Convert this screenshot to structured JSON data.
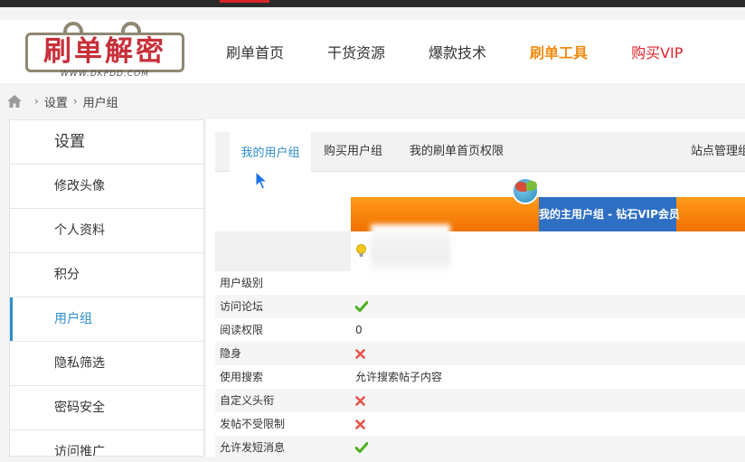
{
  "logo": {
    "text": "刷单解密",
    "subtext": "WWW.DKPDD.COM"
  },
  "nav": {
    "items": [
      {
        "label": "刷单首页"
      },
      {
        "label": "干货资源"
      },
      {
        "label": "爆款技术"
      },
      {
        "label": "刷单工具"
      },
      {
        "label": "购买VIP"
      }
    ]
  },
  "breadcrumb": {
    "home_icon": "home-icon",
    "items": [
      "设置",
      "用户组"
    ]
  },
  "sidebar": {
    "title": "设置",
    "items": [
      {
        "label": "修改头像"
      },
      {
        "label": "个人资料"
      },
      {
        "label": "积分"
      },
      {
        "label": "用户组"
      },
      {
        "label": "隐私筛选"
      },
      {
        "label": "密码安全"
      },
      {
        "label": "访问推广"
      }
    ],
    "active_index": 3
  },
  "tabs": [
    {
      "label": "我的用户组"
    },
    {
      "label": "购买用户组"
    },
    {
      "label": "我的刷单首页权限"
    },
    {
      "label": "站点管理组"
    }
  ],
  "group": {
    "banner_label": "我的主用户组 - 钻石VIP会员"
  },
  "permissions": [
    {
      "label": "用户级别",
      "value": ""
    },
    {
      "label": "访问论坛",
      "value": "",
      "icon": "check-icon"
    },
    {
      "label": "阅读权限",
      "value": "0"
    },
    {
      "label": "隐身",
      "value": "",
      "icon": "cross-icon"
    },
    {
      "label": "使用搜索",
      "value": "允许搜索帖子内容"
    },
    {
      "label": "自定义头衔",
      "value": "",
      "icon": "cross-icon"
    },
    {
      "label": "发帖不受限制",
      "value": "",
      "icon": "cross-icon"
    },
    {
      "label": "允许发短消息",
      "value": "",
      "icon": "check-icon"
    }
  ],
  "colors": {
    "accent_blue": "#2d8ecb",
    "tools_orange": "#f08c12",
    "vip_red": "#e0242b",
    "banner_orange": "#ff8a00",
    "banner_label_blue": "#2e6fc4",
    "check_green": "#4caf1d",
    "cross_red": "#e8524a"
  }
}
